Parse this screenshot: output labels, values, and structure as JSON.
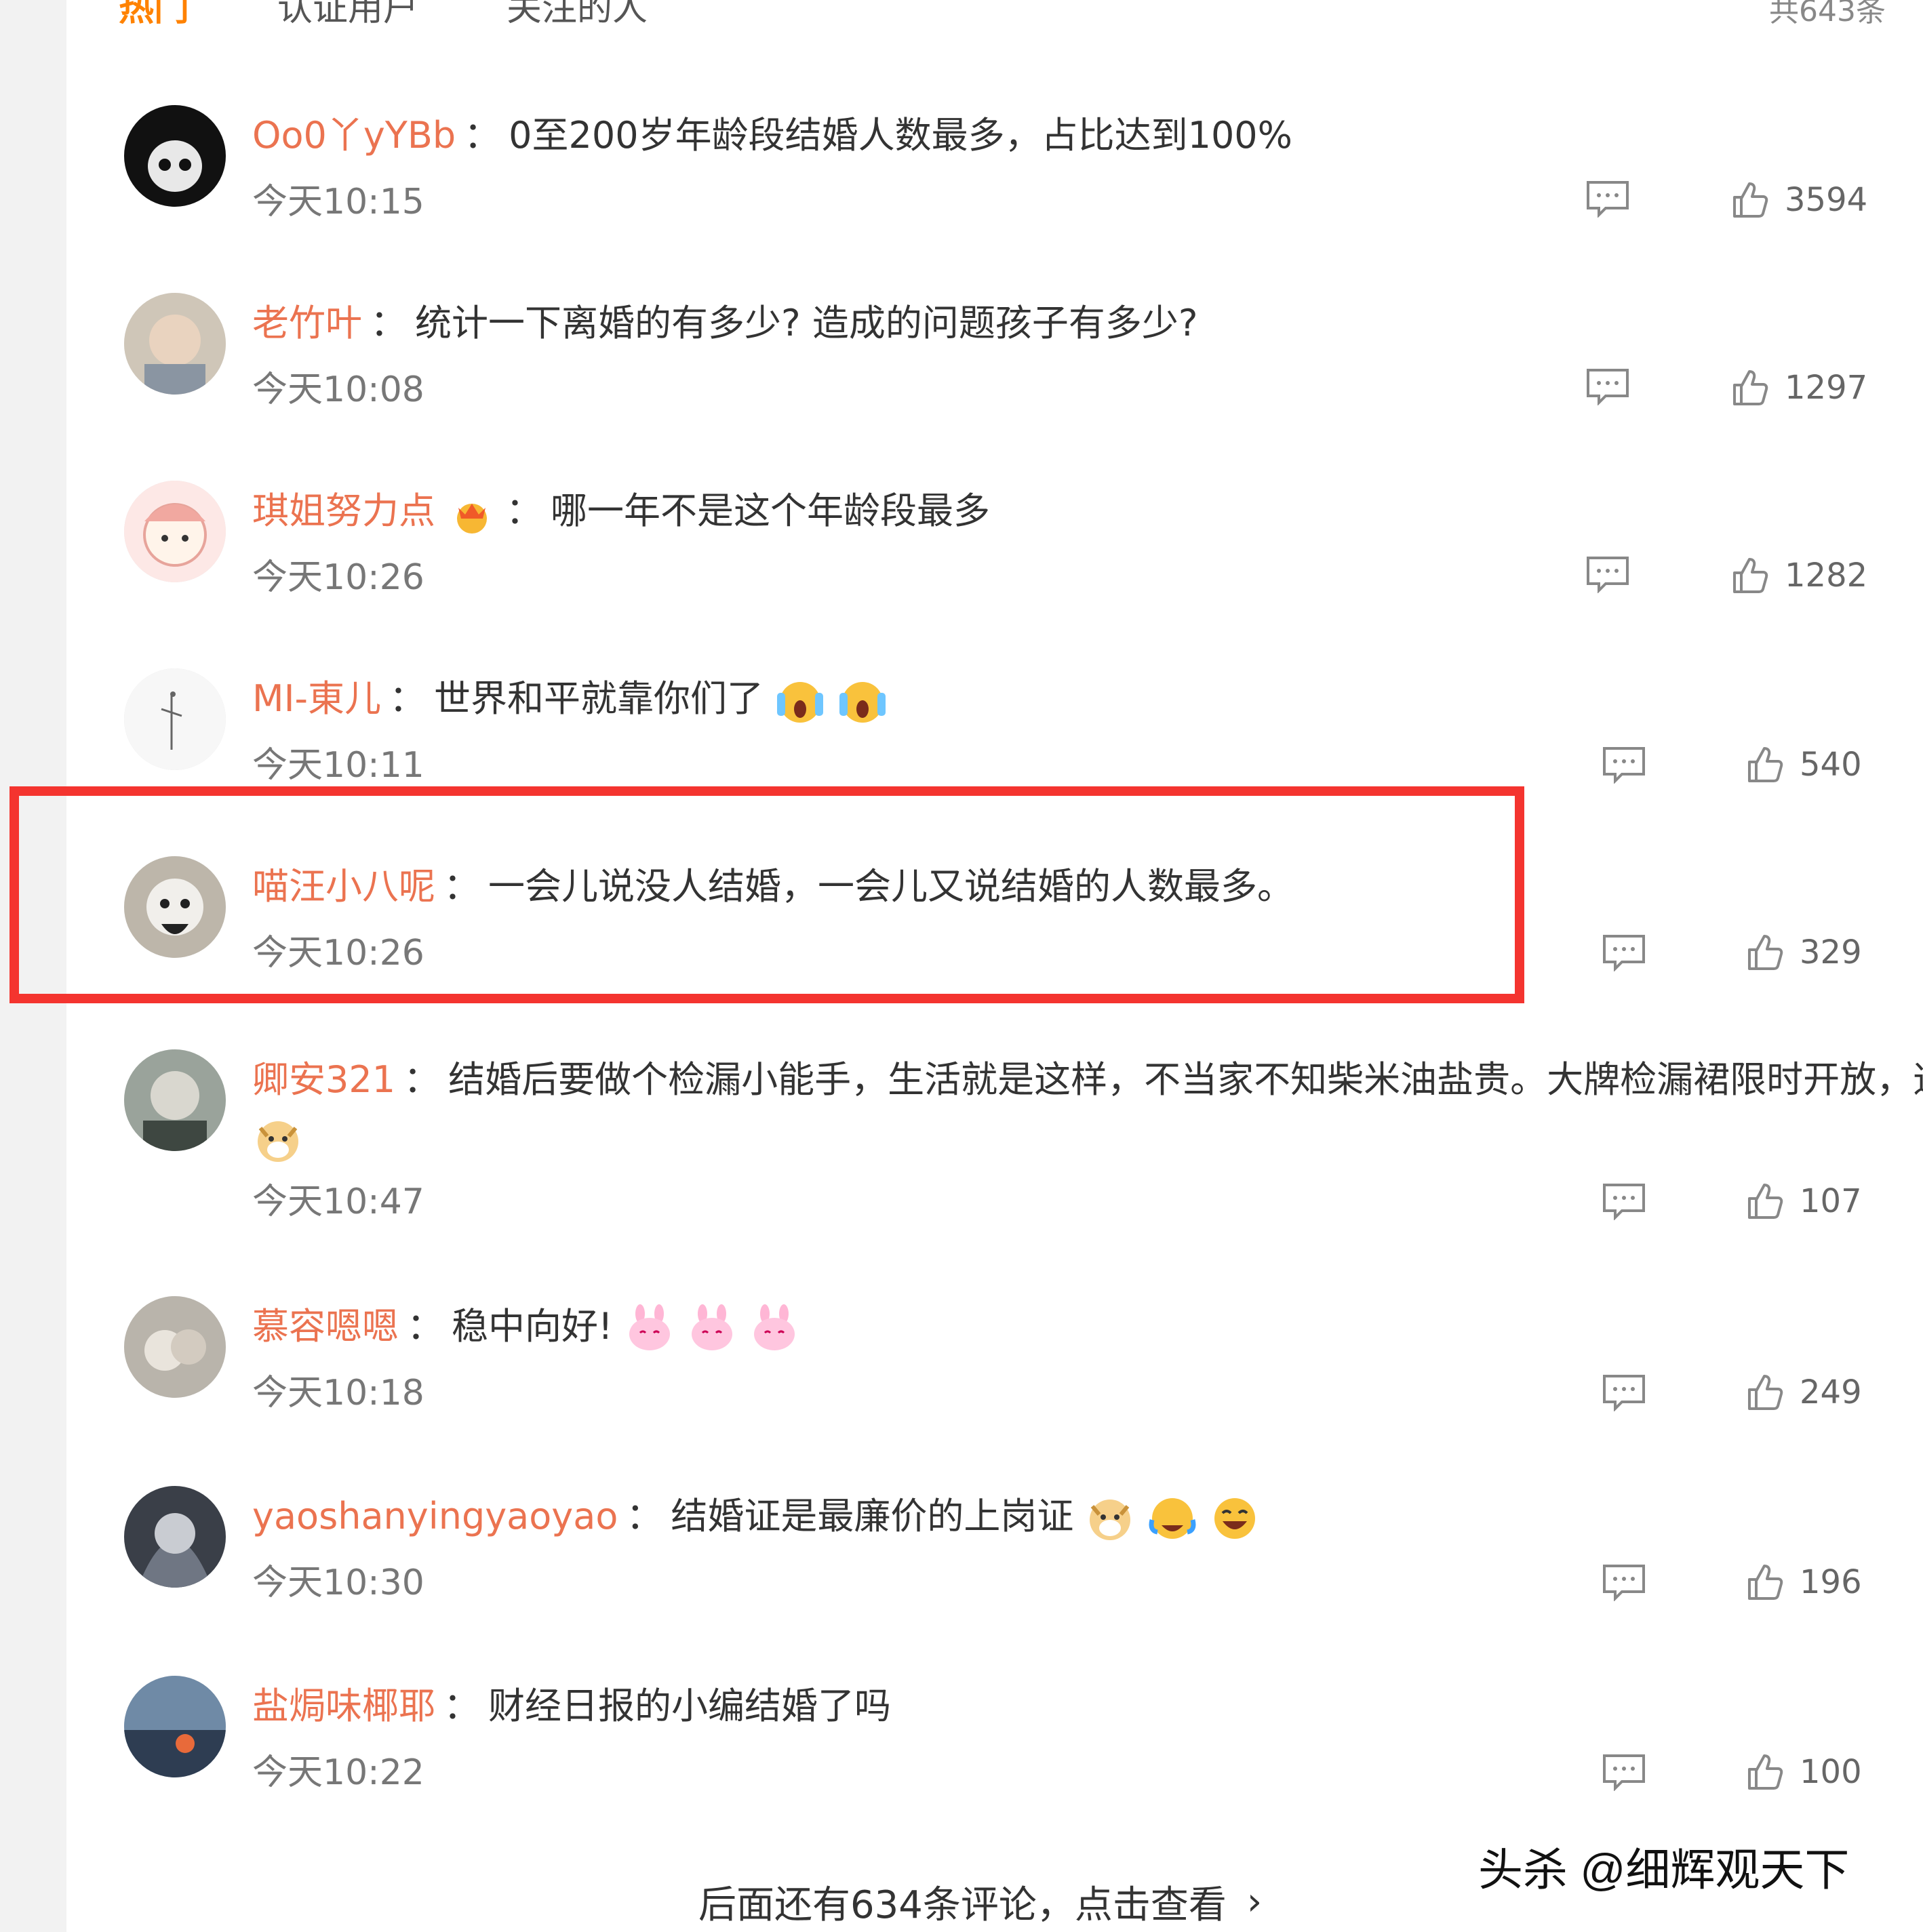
{
  "tabs": [
    "热门",
    "认证用户",
    "关注的人"
  ],
  "total": "共643条",
  "comments": [
    {
      "user": "Oo0丫yYBb",
      "text": "0至200岁年龄段结婚人数最多，占比达到100%",
      "time": "今天10:15",
      "likes": "3594"
    },
    {
      "user": "老竹叶",
      "text": "统计一下离婚的有多少? 造成的问题孩子有多少?",
      "time": "今天10:08",
      "likes": "1297"
    },
    {
      "user": "琪姐努力点",
      "text": "哪一年不是这个年龄段最多",
      "time": "今天10:26",
      "likes": "1282"
    },
    {
      "user": "MI-東儿",
      "text": "世界和平就靠你们了",
      "time": "今天10:11",
      "likes": "540"
    },
    {
      "user": "喵汪小八呢",
      "text": "一会儿说没人结婚，一会儿又说结婚的人数最多。",
      "time": "今天10:26",
      "likes": "329"
    },
    {
      "user": "卿安321",
      "text": "结婚后要做个检漏小能手，生活就是这样，不当家不知柴米油盐贵。大牌检漏裙限时开放，速",
      "time": "今天10:47",
      "likes": "107"
    },
    {
      "user": "慕容嗯嗯",
      "text": "稳中向好!",
      "time": "今天10:18",
      "likes": "249"
    },
    {
      "user": "yaoshanyingyaoyao",
      "text": "结婚证是最廉价的上岗证",
      "time": "今天10:30",
      "likes": "196"
    },
    {
      "user": "盐焗味椰耶",
      "text": "财经日报的小编结婚了吗",
      "time": "今天10:22",
      "likes": "100"
    }
  ],
  "separator": "：",
  "more_text": "后面还有634条评论，点击查看",
  "watermark": "头杀 @细辉观天下",
  "colors": {
    "username": "#eb7350",
    "highlight": "#f4342f",
    "tab_active": "#ff8200"
  }
}
